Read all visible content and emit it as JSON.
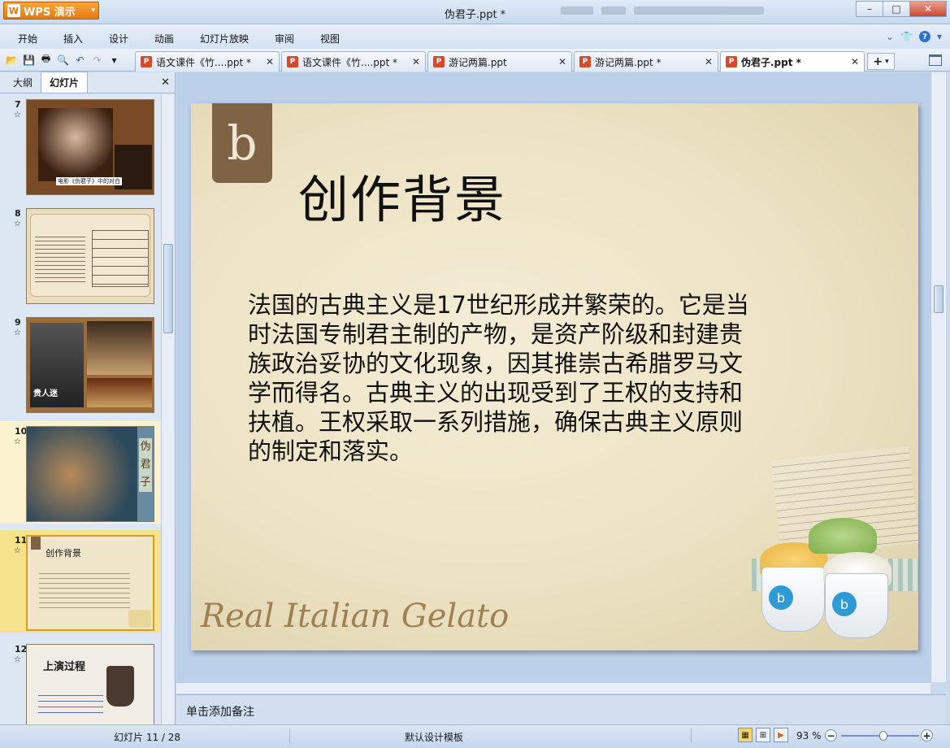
{
  "window": {
    "title": "伪君子.ppt *",
    "app_button": "WPS 演示"
  },
  "menu": {
    "items": [
      "开始",
      "插入",
      "设计",
      "动画",
      "幻灯片放映",
      "审阅",
      "视图"
    ]
  },
  "tabs": [
    {
      "label": "语文课件《竹....ppt *",
      "active": false
    },
    {
      "label": "语文课件《竹....ppt *",
      "active": false
    },
    {
      "label": "游记两篇.ppt",
      "active": false
    },
    {
      "label": "游记两篇.ppt *",
      "active": false
    },
    {
      "label": "伪君子.ppt *",
      "active": true
    }
  ],
  "left_panel": {
    "tabs": [
      "大纲",
      "幻灯片"
    ],
    "active_tab": "幻灯片",
    "thumbs": [
      {
        "num": "7",
        "caption": "电影《伪君子》中的对白"
      },
      {
        "num": "8",
        "caption": ""
      },
      {
        "num": "9",
        "caption": "贵人迷"
      },
      {
        "num": "10",
        "caption": "伪君子"
      },
      {
        "num": "11",
        "caption": "创作背景",
        "selected": true
      },
      {
        "num": "12",
        "caption": "上演过程"
      }
    ]
  },
  "slide": {
    "title": "创作背景",
    "body": "法国的古典主义是17世纪形成并繁荣的。它是当时法国专制君主制的产物，是资产阶级和封建贵族政治妥协的文化现象，因其推崇古希腊罗马文学而得名。古典主义的出现受到了王权的支持和扶植。王权采取一系列措施，确保古典主义原则的制定和落实。",
    "decor_text": "Real Italian Gelato",
    "logo_char": "b"
  },
  "notes": {
    "placeholder": "单击添加备注"
  },
  "status": {
    "slide_info": "幻灯片 11 / 28",
    "template": "默认设计模板",
    "zoom": "93 %",
    "zoom_fraction": 0.55
  },
  "colors": {
    "accent": "#e47a10",
    "selection": "#f6e28c",
    "chrome": "#c9d9ee"
  }
}
